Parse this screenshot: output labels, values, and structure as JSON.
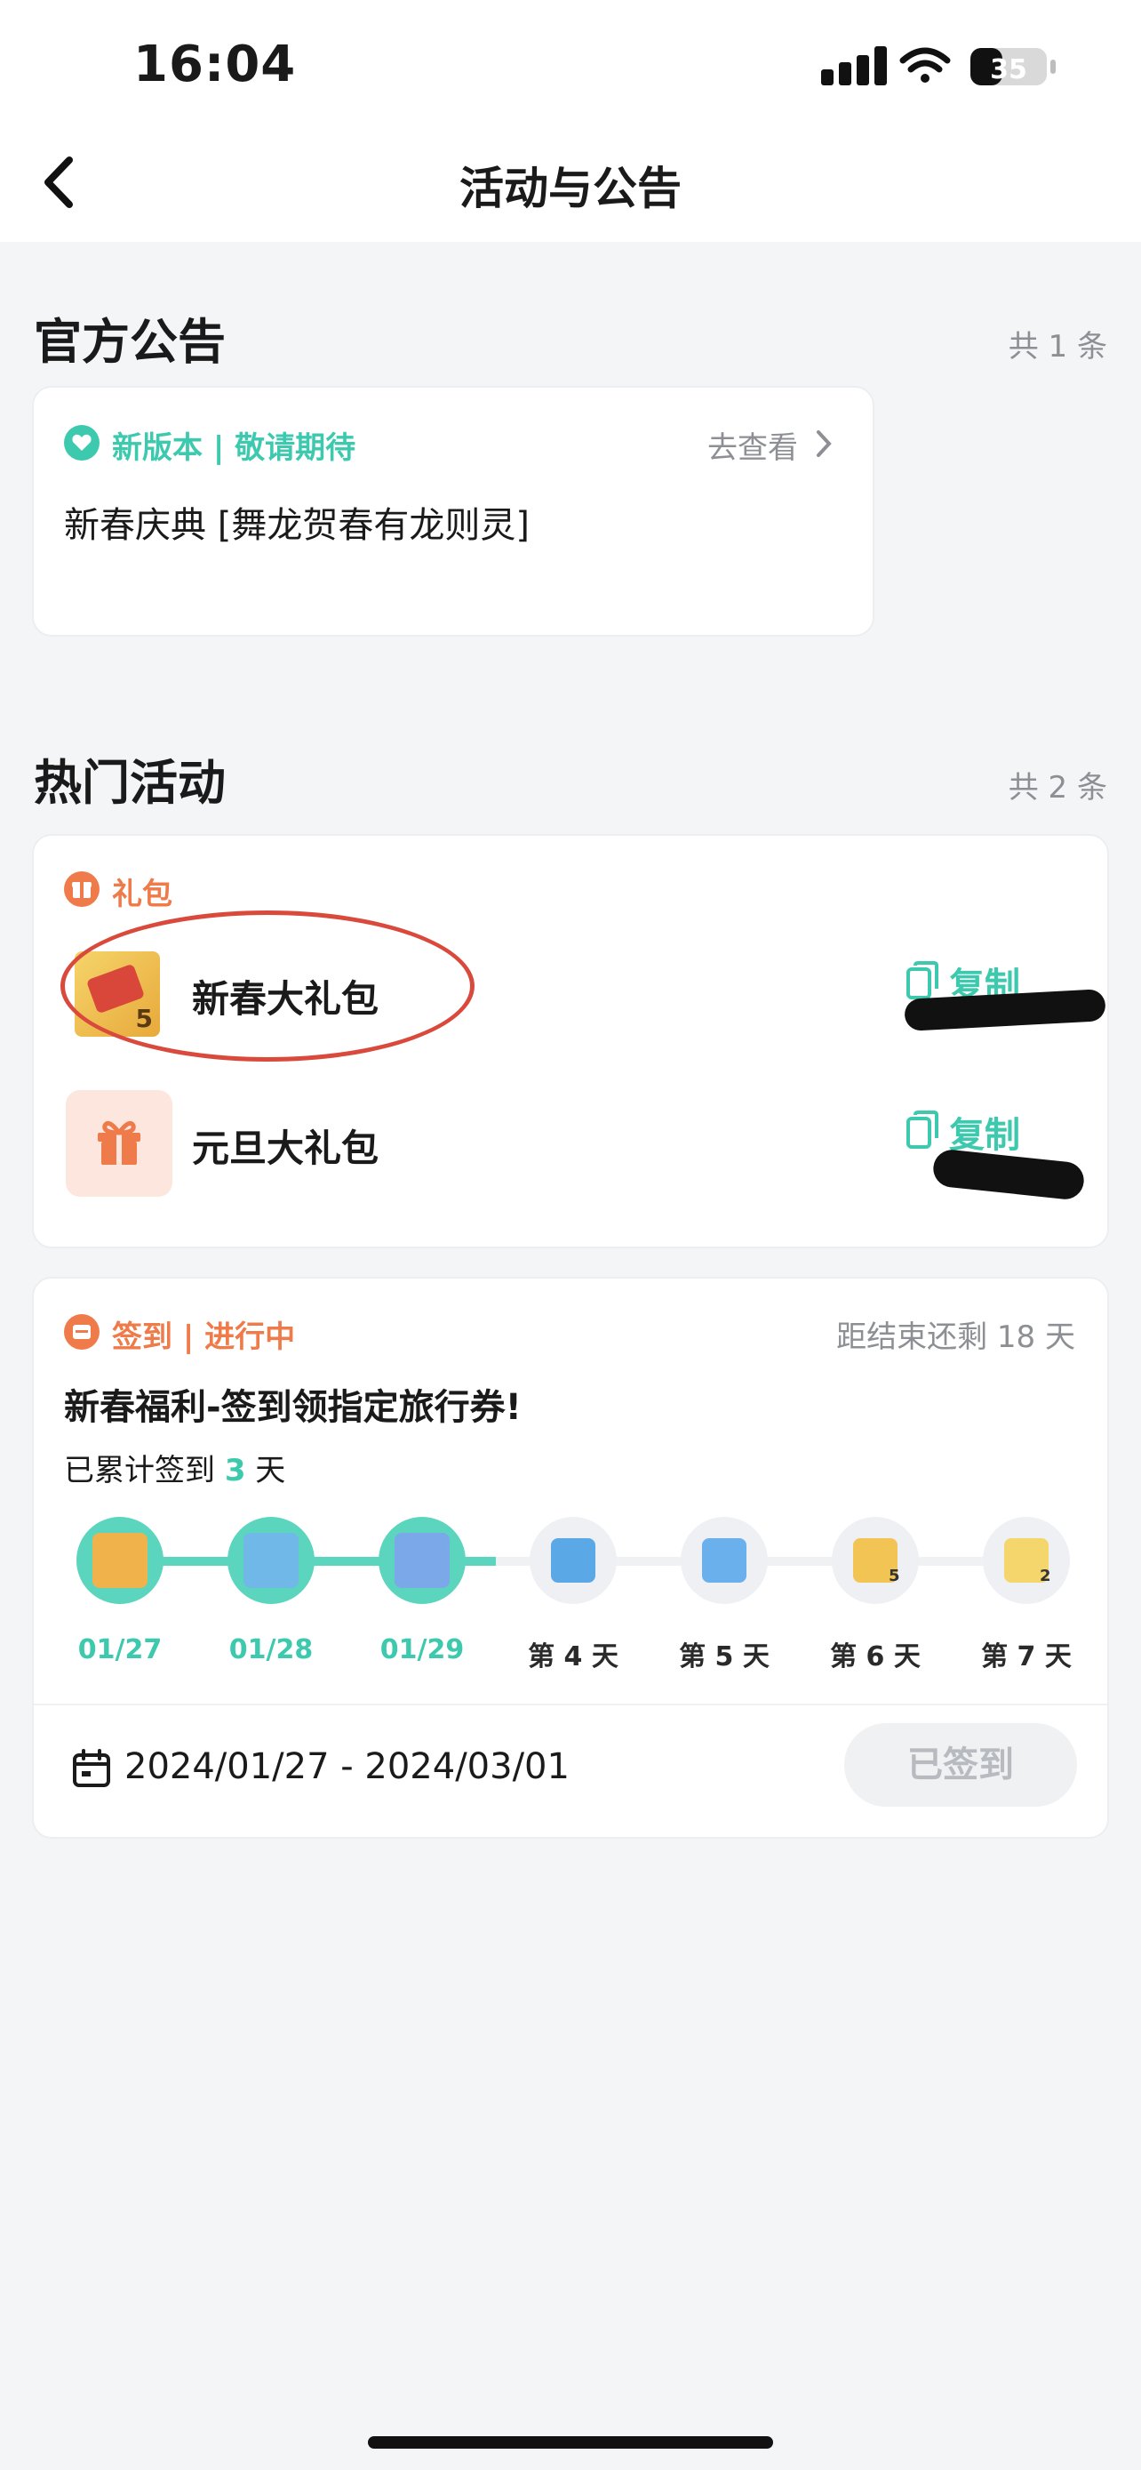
{
  "status_bar": {
    "time": "16:04",
    "battery": "35"
  },
  "nav": {
    "title": "活动与公告"
  },
  "announcements": {
    "title": "官方公告",
    "count": "共 1 条",
    "card": {
      "tag": "新版本 | 敬请期待",
      "link": "去查看",
      "text": "新春庆典 [舞龙贺春有龙则灵]"
    }
  },
  "activities": {
    "title": "热门活动",
    "count": "共 2 条",
    "gift": {
      "tag": "礼包",
      "items": [
        {
          "name": "新春大礼包",
          "copy": "复制",
          "badge": "5"
        },
        {
          "name": "元旦大礼包",
          "copy": "复制"
        }
      ]
    },
    "signin": {
      "tag": "签到 | 进行中",
      "remaining": "距结束还剩 18 天",
      "title": "新春福利-签到领指定旅行券!",
      "progress_prefix": "已累计签到",
      "progress_days": "3",
      "progress_suffix": "天",
      "days": [
        {
          "label": "01/27",
          "done": true
        },
        {
          "label": "01/28",
          "done": true
        },
        {
          "label": "01/29",
          "done": true
        },
        {
          "label": "第 4 天",
          "done": false
        },
        {
          "label": "第 5 天",
          "done": false
        },
        {
          "label": "第 6 天",
          "done": false,
          "badge": "5"
        },
        {
          "label": "第 7 天",
          "done": false,
          "badge": "2"
        }
      ],
      "date_range": "2024/01/27 - 2024/03/01",
      "button": "已签到"
    }
  },
  "colors": {
    "accent": "#3cc9ae",
    "orange": "#ef7a4a",
    "annotation_red": "#d94a3c"
  }
}
